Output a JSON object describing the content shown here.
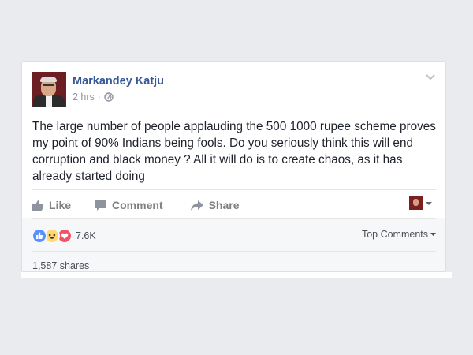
{
  "post": {
    "author": "Markandey Katju",
    "time": "2 hrs",
    "privacy_icon": "globe-icon",
    "text": "The large number of people applauding the 500 1000 rupee scheme proves my point of 90% Indians being fools. Do you seriously think this will end corruption and black money ? All it will do is to create chaos, as it has already started doing"
  },
  "actions": {
    "like_label": "Like",
    "comment_label": "Comment",
    "share_label": "Share"
  },
  "reactions": {
    "types": [
      "like",
      "haha",
      "love"
    ],
    "count": "7.6K",
    "sort_label": "Top Comments"
  },
  "shares_label": "1,587 shares",
  "colors": {
    "author_link": "#365899",
    "page_bg": "#e9ebee",
    "like_blue": "#5890ff",
    "love_red": "#f25268",
    "haha_yellow": "#ffd972"
  }
}
